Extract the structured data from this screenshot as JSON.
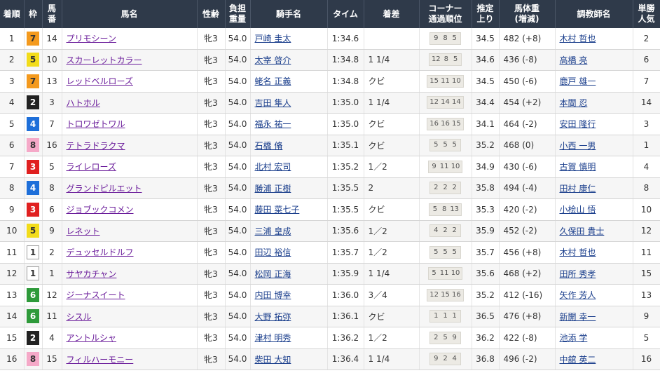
{
  "headers": {
    "chakujun": "着順",
    "waku": "枠",
    "umaban_1": "馬",
    "umaban_2": "番",
    "horse": "馬名",
    "sexage": "性齢",
    "weight_1": "負担",
    "weight_2": "重量",
    "jockey": "騎手名",
    "time": "タイム",
    "margin": "着差",
    "corner_1": "コーナー",
    "corner_2": "通過順位",
    "agari_1": "推定",
    "agari_2": "上り",
    "body_1": "馬体重",
    "body_2": "(増減)",
    "trainer": "調教師名",
    "pop_1": "単勝",
    "pop_2": "人気"
  },
  "rows": [
    {
      "rank": "1",
      "waku": "7",
      "umaban": "14",
      "horse": "プリモシーン",
      "sexage": "牝3",
      "weight": "54.0",
      "jockey": "戸崎 圭太",
      "time": "1:34.6",
      "margin": "",
      "corner": [
        "9",
        "8",
        "5"
      ],
      "agari": "34.5",
      "body": "482 (+8)",
      "trainer": "木村 哲也",
      "pop": "2"
    },
    {
      "rank": "2",
      "waku": "5",
      "umaban": "10",
      "horse": "スカーレットカラー",
      "sexage": "牝3",
      "weight": "54.0",
      "jockey": "太宰 啓介",
      "time": "1:34.8",
      "margin": "1 1/4",
      "corner": [
        "12",
        "8",
        "5"
      ],
      "agari": "34.6",
      "body": "436 (-8)",
      "trainer": "高橋 亮",
      "pop": "6"
    },
    {
      "rank": "3",
      "waku": "7",
      "umaban": "13",
      "horse": "レッドベルローズ",
      "sexage": "牝3",
      "weight": "54.0",
      "jockey": "蛯名 正義",
      "time": "1:34.8",
      "margin": "クビ",
      "corner": [
        "15",
        "11",
        "10"
      ],
      "agari": "34.5",
      "body": "450 (-6)",
      "trainer": "鹿戸 雄一",
      "pop": "7"
    },
    {
      "rank": "4",
      "waku": "2",
      "umaban": "3",
      "horse": "ハトホル",
      "sexage": "牝3",
      "weight": "54.0",
      "jockey": "吉田 隼人",
      "time": "1:35.0",
      "margin": "1 1/4",
      "corner": [
        "12",
        "14",
        "14"
      ],
      "agari": "34.4",
      "body": "454 (+2)",
      "trainer": "本間 忍",
      "pop": "14"
    },
    {
      "rank": "5",
      "waku": "4",
      "umaban": "7",
      "horse": "トロワゼトワル",
      "sexage": "牝3",
      "weight": "54.0",
      "jockey": "福永 祐一",
      "time": "1:35.0",
      "margin": "クビ",
      "corner": [
        "16",
        "16",
        "15"
      ],
      "agari": "34.1",
      "body": "464 (-2)",
      "trainer": "安田 隆行",
      "pop": "3"
    },
    {
      "rank": "6",
      "waku": "8",
      "umaban": "16",
      "horse": "テトラドラクマ",
      "sexage": "牝3",
      "weight": "54.0",
      "jockey": "石橋 脩",
      "time": "1:35.1",
      "margin": "クビ",
      "corner": [
        "5",
        "5",
        "5"
      ],
      "agari": "35.2",
      "body": "468 (0)",
      "trainer": "小西 一男",
      "pop": "1"
    },
    {
      "rank": "7",
      "waku": "3",
      "umaban": "5",
      "horse": "ライレローズ",
      "sexage": "牝3",
      "weight": "54.0",
      "jockey": "北村 宏司",
      "time": "1:35.2",
      "margin": "1／2",
      "corner": [
        "9",
        "11",
        "10"
      ],
      "agari": "34.9",
      "body": "430 (-6)",
      "trainer": "古賀 慎明",
      "pop": "4"
    },
    {
      "rank": "8",
      "waku": "4",
      "umaban": "8",
      "horse": "グランドピルエット",
      "sexage": "牝3",
      "weight": "54.0",
      "jockey": "勝浦 正樹",
      "time": "1:35.5",
      "margin": "2",
      "corner": [
        "2",
        "2",
        "2"
      ],
      "agari": "35.8",
      "body": "494 (-4)",
      "trainer": "田村 康仁",
      "pop": "8"
    },
    {
      "rank": "9",
      "waku": "3",
      "umaban": "6",
      "horse": "ジョブックコメン",
      "sexage": "牝3",
      "weight": "54.0",
      "jockey": "藤田 菜七子",
      "time": "1:35.5",
      "margin": "クビ",
      "corner": [
        "5",
        "8",
        "13"
      ],
      "agari": "35.3",
      "body": "420 (-2)",
      "trainer": "小桧山 悟",
      "pop": "10"
    },
    {
      "rank": "10",
      "waku": "5",
      "umaban": "9",
      "horse": "レネット",
      "sexage": "牝3",
      "weight": "54.0",
      "jockey": "三浦 皇成",
      "time": "1:35.6",
      "margin": "1／2",
      "corner": [
        "4",
        "2",
        "2"
      ],
      "agari": "35.9",
      "body": "452 (-2)",
      "trainer": "久保田 貴士",
      "pop": "12"
    },
    {
      "rank": "11",
      "waku": "1",
      "umaban": "2",
      "horse": "デュッセルドルフ",
      "sexage": "牝3",
      "weight": "54.0",
      "jockey": "田辺 裕信",
      "time": "1:35.7",
      "margin": "1／2",
      "corner": [
        "5",
        "5",
        "5"
      ],
      "agari": "35.7",
      "body": "456 (+8)",
      "trainer": "木村 哲也",
      "pop": "11"
    },
    {
      "rank": "12",
      "waku": "1",
      "umaban": "1",
      "horse": "サヤカチャン",
      "sexage": "牝3",
      "weight": "54.0",
      "jockey": "松岡 正海",
      "time": "1:35.9",
      "margin": "1 1/4",
      "corner": [
        "5",
        "11",
        "10"
      ],
      "agari": "35.6",
      "body": "468 (+2)",
      "trainer": "田所 秀孝",
      "pop": "15"
    },
    {
      "rank": "13",
      "waku": "6",
      "umaban": "12",
      "horse": "ジーナスイート",
      "sexage": "牝3",
      "weight": "54.0",
      "jockey": "内田 博幸",
      "time": "1:36.0",
      "margin": "3／4",
      "corner": [
        "12",
        "15",
        "16"
      ],
      "agari": "35.2",
      "body": "412 (-16)",
      "trainer": "矢作 芳人",
      "pop": "13"
    },
    {
      "rank": "14",
      "waku": "6",
      "umaban": "11",
      "horse": "シスル",
      "sexage": "牝3",
      "weight": "54.0",
      "jockey": "大野 拓弥",
      "time": "1:36.1",
      "margin": "クビ",
      "corner": [
        "1",
        "1",
        "1"
      ],
      "agari": "36.5",
      "body": "476 (+8)",
      "trainer": "新開 幸一",
      "pop": "9"
    },
    {
      "rank": "15",
      "waku": "2",
      "umaban": "4",
      "horse": "アントルシャ",
      "sexage": "牝3",
      "weight": "54.0",
      "jockey": "津村 明秀",
      "time": "1:36.2",
      "margin": "1／2",
      "corner": [
        "2",
        "5",
        "9"
      ],
      "agari": "36.2",
      "body": "422 (-8)",
      "trainer": "池添 学",
      "pop": "5"
    },
    {
      "rank": "16",
      "waku": "8",
      "umaban": "15",
      "horse": "フィルハーモニー",
      "sexage": "牝3",
      "weight": "54.0",
      "jockey": "柴田 大知",
      "time": "1:36.4",
      "margin": "1 1/4",
      "corner": [
        "9",
        "2",
        "4"
      ],
      "agari": "36.8",
      "body": "496 (-2)",
      "trainer": "中舘 英二",
      "pop": "16"
    }
  ],
  "waku_colors": {
    "1": "#ffffff",
    "2": "#222222",
    "3": "#e02020",
    "4": "#1e6fd9",
    "5": "#f2dc1a",
    "6": "#2e9a3a",
    "7": "#f49a1e",
    "8": "#f5a9c8"
  },
  "link_colors": {
    "horse": "#6a1b9a",
    "person": "#1a3e8c"
  },
  "header_bg": "#2f3a4a"
}
